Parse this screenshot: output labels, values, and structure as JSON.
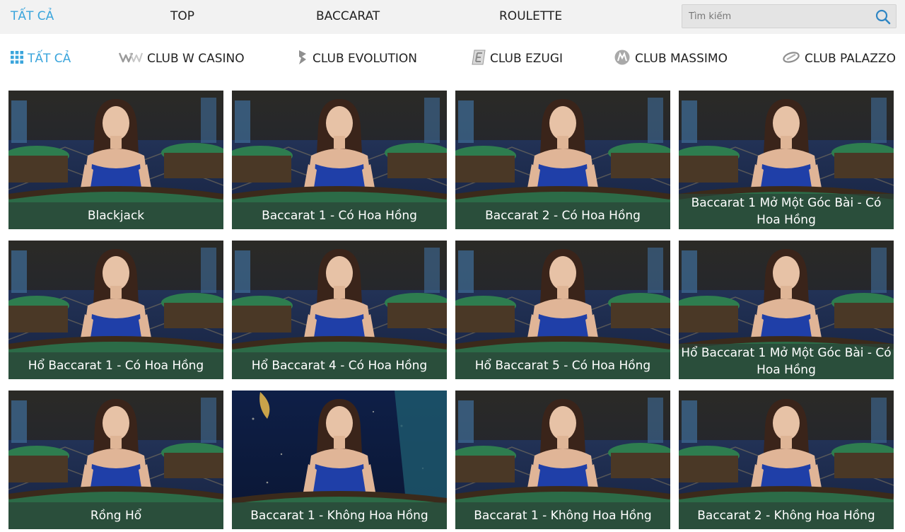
{
  "top_nav": {
    "tabs": [
      {
        "label": "TẤT CẢ",
        "active": true
      },
      {
        "label": "TOP",
        "active": false
      },
      {
        "label": "BACCARAT",
        "active": false
      },
      {
        "label": "ROULETTE",
        "active": false
      }
    ],
    "search": {
      "placeholder": "Tìm kiếm",
      "value": ""
    }
  },
  "club_nav": {
    "items": [
      {
        "label": "TẤT CẢ",
        "icon": "grid-icon",
        "active": true
      },
      {
        "label": "CLUB W CASINO",
        "icon": "w-casino-logo-icon",
        "active": false
      },
      {
        "label": "CLUB EVOLUTION",
        "icon": "evolution-logo-icon",
        "active": false
      },
      {
        "label": "CLUB EZUGI",
        "icon": "ezugi-logo-icon",
        "active": false
      },
      {
        "label": "CLUB MASSIMO",
        "icon": "massimo-logo-icon",
        "active": false
      },
      {
        "label": "CLUB PALAZZO",
        "icon": "palazzo-logo-icon",
        "active": false
      }
    ]
  },
  "colors": {
    "accent": "#3aa5dc",
    "topbar_bg": "#f2f2f2",
    "caption_bg": "#2a4238",
    "dress": "#1f3fa8",
    "felt": "#2e7d4f"
  },
  "games": [
    {
      "title": "Blackjack"
    },
    {
      "title": "Baccarat 1 - Có Hoa Hồng"
    },
    {
      "title": "Baccarat 2 - Có Hoa Hồng"
    },
    {
      "title": "Baccarat 1 Mở Một Góc Bài - Có Hoa Hồng"
    },
    {
      "title": "Hổ Baccarat 1 - Có Hoa Hồng"
    },
    {
      "title": "Hổ Baccarat 4 - Có Hoa Hồng"
    },
    {
      "title": "Hổ Baccarat 5 - Có Hoa Hồng"
    },
    {
      "title": "Hổ Baccarat 1 Mở Một Góc Bài - Có Hoa Hồng"
    },
    {
      "title": "Rồng Hổ"
    },
    {
      "title": "Baccarat 1 - Không Hoa Hồng"
    },
    {
      "title": "Baccarat 1 - Không Hoa Hồng"
    },
    {
      "title": "Baccarat 2 - Không Hoa Hồng"
    }
  ]
}
